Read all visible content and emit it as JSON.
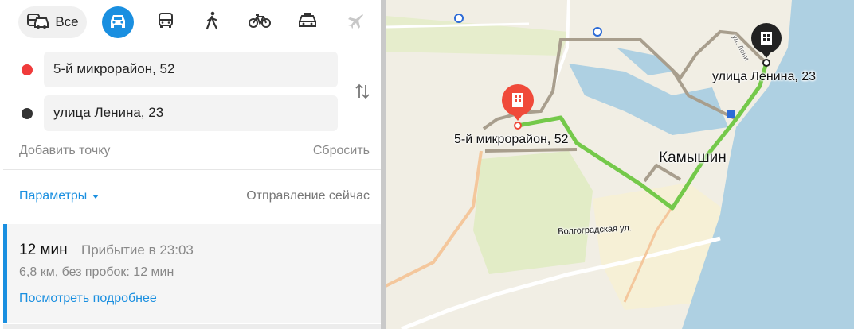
{
  "transport_modes": {
    "all_label": "Все",
    "items": [
      {
        "name": "all",
        "icon": "car-and-bus-icon",
        "active": false
      },
      {
        "name": "car",
        "icon": "car-icon",
        "active": true
      },
      {
        "name": "transit",
        "icon": "bus-icon",
        "active": false
      },
      {
        "name": "walk",
        "icon": "walking-person-icon",
        "active": false
      },
      {
        "name": "bike",
        "icon": "bicycle-icon",
        "active": false
      },
      {
        "name": "taxi",
        "icon": "taxi-icon",
        "active": false
      },
      {
        "name": "plane",
        "icon": "plane-icon",
        "active": false
      }
    ]
  },
  "route_form": {
    "from": "5-й микрорайон, 52",
    "to": "улица Ленина, 23",
    "add_point": "Добавить точку",
    "reset": "Сбросить"
  },
  "options": {
    "params_label": "Параметры",
    "departure": "Отправление сейчас"
  },
  "route_result": {
    "duration": "12 мин",
    "arrival": "Прибытие в 23:03",
    "distance": "6,8 км, без пробок: 12 мин",
    "details_link": "Посмотреть подробнее"
  },
  "map": {
    "labels": {
      "start": "5-й микрорайон, 52",
      "end": "улица Ленина, 23",
      "city": "Камышин",
      "street": "Волгоградская ул.",
      "street_small": "ул. Лени"
    }
  },
  "colors": {
    "accent": "#1a8fe0",
    "start_marker": "#f04a3a",
    "end_marker": "#222222",
    "route": "#74c94a",
    "alt_route": "#a89e8d",
    "water": "#aed0e2",
    "land": "#f1eee4"
  }
}
